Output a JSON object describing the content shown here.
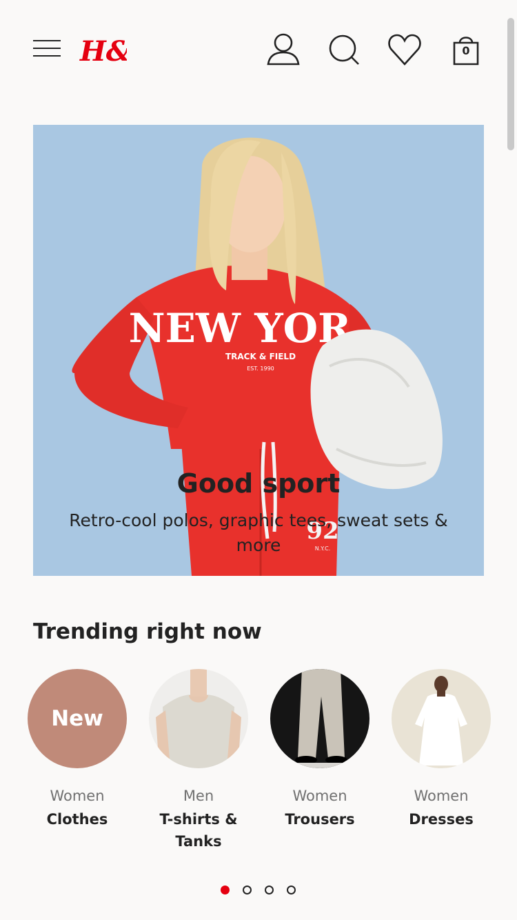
{
  "header": {
    "logo_text": "H&M",
    "bag_count": "0",
    "icons": [
      "menu-icon",
      "account-icon",
      "search-icon",
      "heart-icon",
      "shopping-bag-icon"
    ]
  },
  "hero": {
    "title": "Good sport",
    "subtitle": "Retro-cool polos, graphic tees, sweat sets & more",
    "shirt_text": "NEW YOR",
    "shirt_sub1": "TRACK & FIELD",
    "shirt_sub2": "EST. 1990",
    "pants_text": "92",
    "pants_sub": "N.Y.C."
  },
  "trending": {
    "title": "Trending right now",
    "items": [
      {
        "badge": "New",
        "category": "Women",
        "label": "Clothes"
      },
      {
        "category": "Men",
        "label": "T-shirts & Tanks"
      },
      {
        "category": "Women",
        "label": "Trousers"
      },
      {
        "category": "Women",
        "label": "Dresses"
      }
    ]
  },
  "pagination": {
    "pages": 4,
    "active": 1
  },
  "colors": {
    "brand": "#e50010",
    "background": "#faf9f8",
    "new_badge": "#c08a79",
    "hero_bg": "#a9c7e2"
  }
}
